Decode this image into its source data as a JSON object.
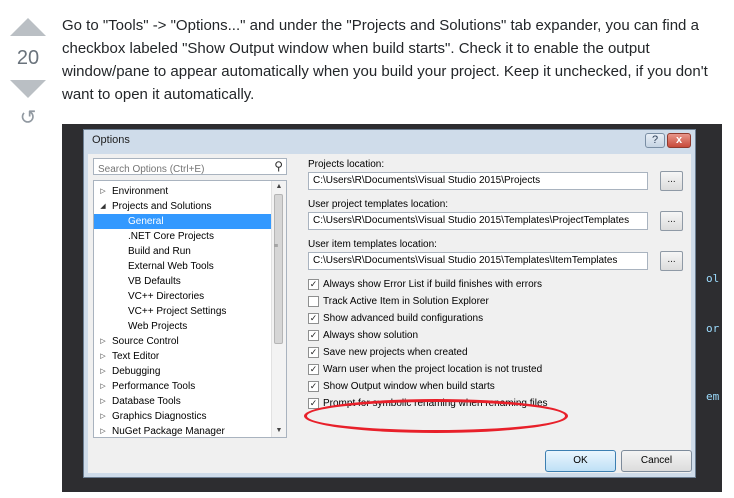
{
  "answer": {
    "vote_score": "20",
    "text": "Go to \"Tools\" -> \"Options...\" and under the \"Projects and Solutions\" tab expander, you can find a checkbox labeled \"Show Output window when build starts\". Check it to enable the output window/pane to appear automatically when you build your project. Keep it unchecked, if you don't want to open it automatically."
  },
  "dialog": {
    "title": "Options",
    "help_label": "?",
    "close_label": "x",
    "search_placeholder": "Search Options (Ctrl+E)",
    "tree": [
      {
        "label": "Environment",
        "expander": "▷",
        "selected": false
      },
      {
        "label": "Projects and Solutions",
        "expander": "◢",
        "selected": false
      },
      {
        "label": "General",
        "expander": "",
        "selected": true
      },
      {
        "label": ".NET Core Projects",
        "expander": "",
        "selected": false
      },
      {
        "label": "Build and Run",
        "expander": "",
        "selected": false
      },
      {
        "label": "External Web Tools",
        "expander": "",
        "selected": false
      },
      {
        "label": "VB Defaults",
        "expander": "",
        "selected": false
      },
      {
        "label": "VC++ Directories",
        "expander": "",
        "selected": false
      },
      {
        "label": "VC++ Project Settings",
        "expander": "",
        "selected": false
      },
      {
        "label": "Web Projects",
        "expander": "",
        "selected": false
      },
      {
        "label": "Source Control",
        "expander": "▷",
        "selected": false
      },
      {
        "label": "Text Editor",
        "expander": "▷",
        "selected": false
      },
      {
        "label": "Debugging",
        "expander": "▷",
        "selected": false
      },
      {
        "label": "Performance Tools",
        "expander": "▷",
        "selected": false
      },
      {
        "label": "Database Tools",
        "expander": "▷",
        "selected": false
      },
      {
        "label": "Graphics Diagnostics",
        "expander": "▷",
        "selected": false
      },
      {
        "label": "NuGet Package Manager",
        "expander": "▷",
        "selected": false
      }
    ],
    "fields": [
      {
        "label": "Projects location:",
        "value": "C:\\Users\\R\\Documents\\Visual Studio 2015\\Projects",
        "browse_label": "..."
      },
      {
        "label": "User project templates location:",
        "value": "C:\\Users\\R\\Documents\\Visual Studio 2015\\Templates\\ProjectTemplates",
        "browse_label": "..."
      },
      {
        "label": "User item templates location:",
        "value": "C:\\Users\\R\\Documents\\Visual Studio 2015\\Templates\\ItemTemplates",
        "browse_label": "..."
      }
    ],
    "checkboxes": [
      {
        "label": "Always show Error List if build finishes with errors",
        "checked": true
      },
      {
        "label": "Track Active Item in Solution Explorer",
        "checked": false
      },
      {
        "label": "Show advanced build configurations",
        "checked": true
      },
      {
        "label": "Always show solution",
        "checked": true
      },
      {
        "label": "Save new projects when created",
        "checked": true
      },
      {
        "label": "Warn user when the project location is not trusted",
        "checked": true
      },
      {
        "label": "Show Output window when build starts",
        "checked": true
      },
      {
        "label": "Prompt for symbolic renaming when renaming files",
        "checked": true
      }
    ],
    "ok_label": "OK",
    "cancel_label": "Cancel"
  },
  "background_code": {
    "side_fragments": [
      "ol",
      "or",
      "em"
    ]
  },
  "colors": {
    "selection": "#3399ff",
    "highlight_ellipse": "#e8202a",
    "vs_background": "#2d2d30"
  }
}
